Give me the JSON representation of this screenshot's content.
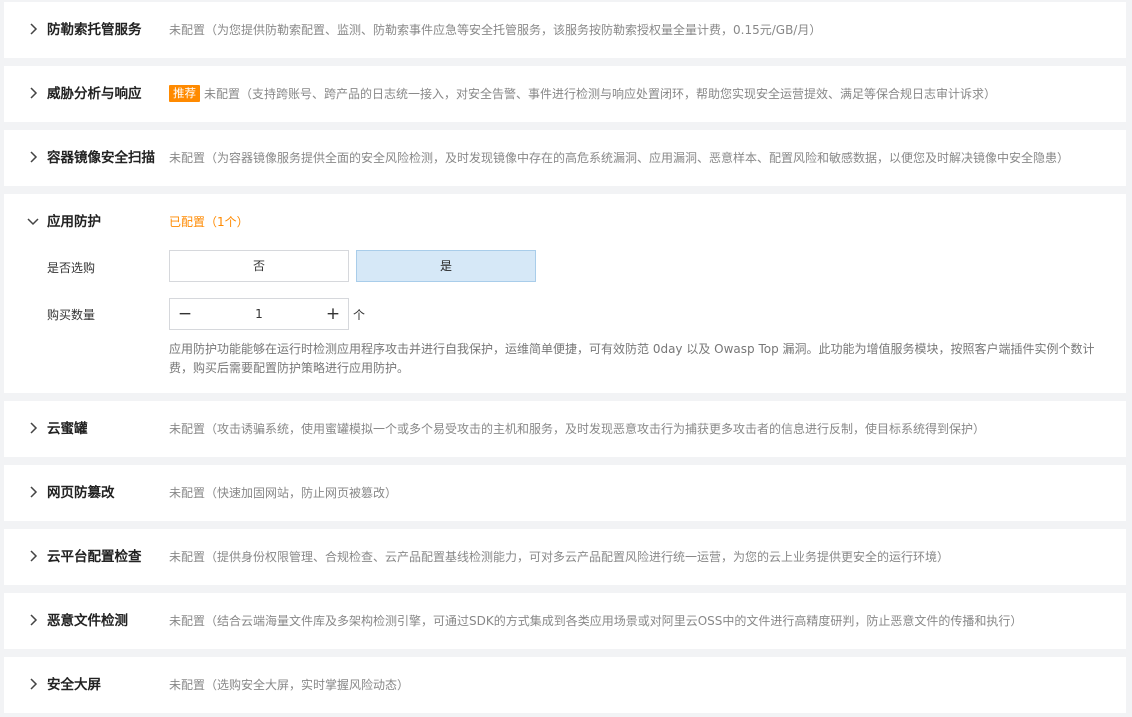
{
  "chevron_collapsed_icon": "chevron-right-icon",
  "chevron_expanded_icon": "chevron-down-icon",
  "accent_color": "#ff8a00",
  "rows": [
    {
      "title": "防勒索托管服务",
      "description": "未配置（为您提供防勒索配置、监测、防勒索事件应急等安全托管服务，该服务按防勒索授权量全量计费，0.15元/GB/月）",
      "expanded": false
    },
    {
      "title": "威胁分析与响应",
      "badge": "推荐",
      "description": "未配置（支持跨账号、跨产品的日志统一接入，对安全告警、事件进行检测与响应处置闭环，帮助您实现安全运营提效、满足等保合规日志审计诉求）",
      "expanded": false
    },
    {
      "title": "容器镜像安全扫描",
      "description": "未配置（为容器镜像服务提供全面的安全风险检测，及时发现镜像中存在的高危系统漏洞、应用漏洞、恶意样本、配置风险和敏感数据，以便您及时解决镜像中安全隐患）",
      "expanded": false
    },
    {
      "title": "应用防护",
      "description": "已配置（1个）",
      "expanded": true
    },
    {
      "title": "云蜜罐",
      "description": "未配置（攻击诱骗系统，使用蜜罐模拟一个或多个易受攻击的主机和服务，及时发现恶意攻击行为捕获更多攻击者的信息进行反制，使目标系统得到保护）",
      "expanded": false
    },
    {
      "title": "网页防篡改",
      "description": "未配置（快速加固网站，防止网页被篡改）",
      "expanded": false
    },
    {
      "title": "云平台配置检查",
      "description": "未配置（提供身份权限管理、合规检查、云产品配置基线检测能力，可对多云产品配置风险进行统一运营，为您的云上业务提供更安全的运行环境）",
      "expanded": false
    },
    {
      "title": "恶意文件检测",
      "description": "未配置（结合云端海量文件库及多架构检测引擎，可通过SDK的方式集成到各类应用场景或对阿里云OSS中的文件进行高精度研判，防止恶意文件的传播和执行）",
      "expanded": false
    },
    {
      "title": "安全大屏",
      "description": "未配置（选购安全大屏，实时掌握风险动态）",
      "expanded": false
    }
  ],
  "app_protection": {
    "select_label": "是否选购",
    "option_no": "否",
    "option_yes": "是",
    "selected": "是",
    "quantity_label": "购买数量",
    "quantity_value": "1",
    "minus_symbol": "−",
    "plus_symbol": "+",
    "unit": "个",
    "help_text": "应用防护功能能够在运行时检测应用程序攻击并进行自我保护，运维简单便捷，可有效防范 0day 以及 Owasp Top 漏洞。此功能为增值服务模块，按照客户端插件实例个数计费，购买后需要配置防护策略进行应用防护。"
  }
}
